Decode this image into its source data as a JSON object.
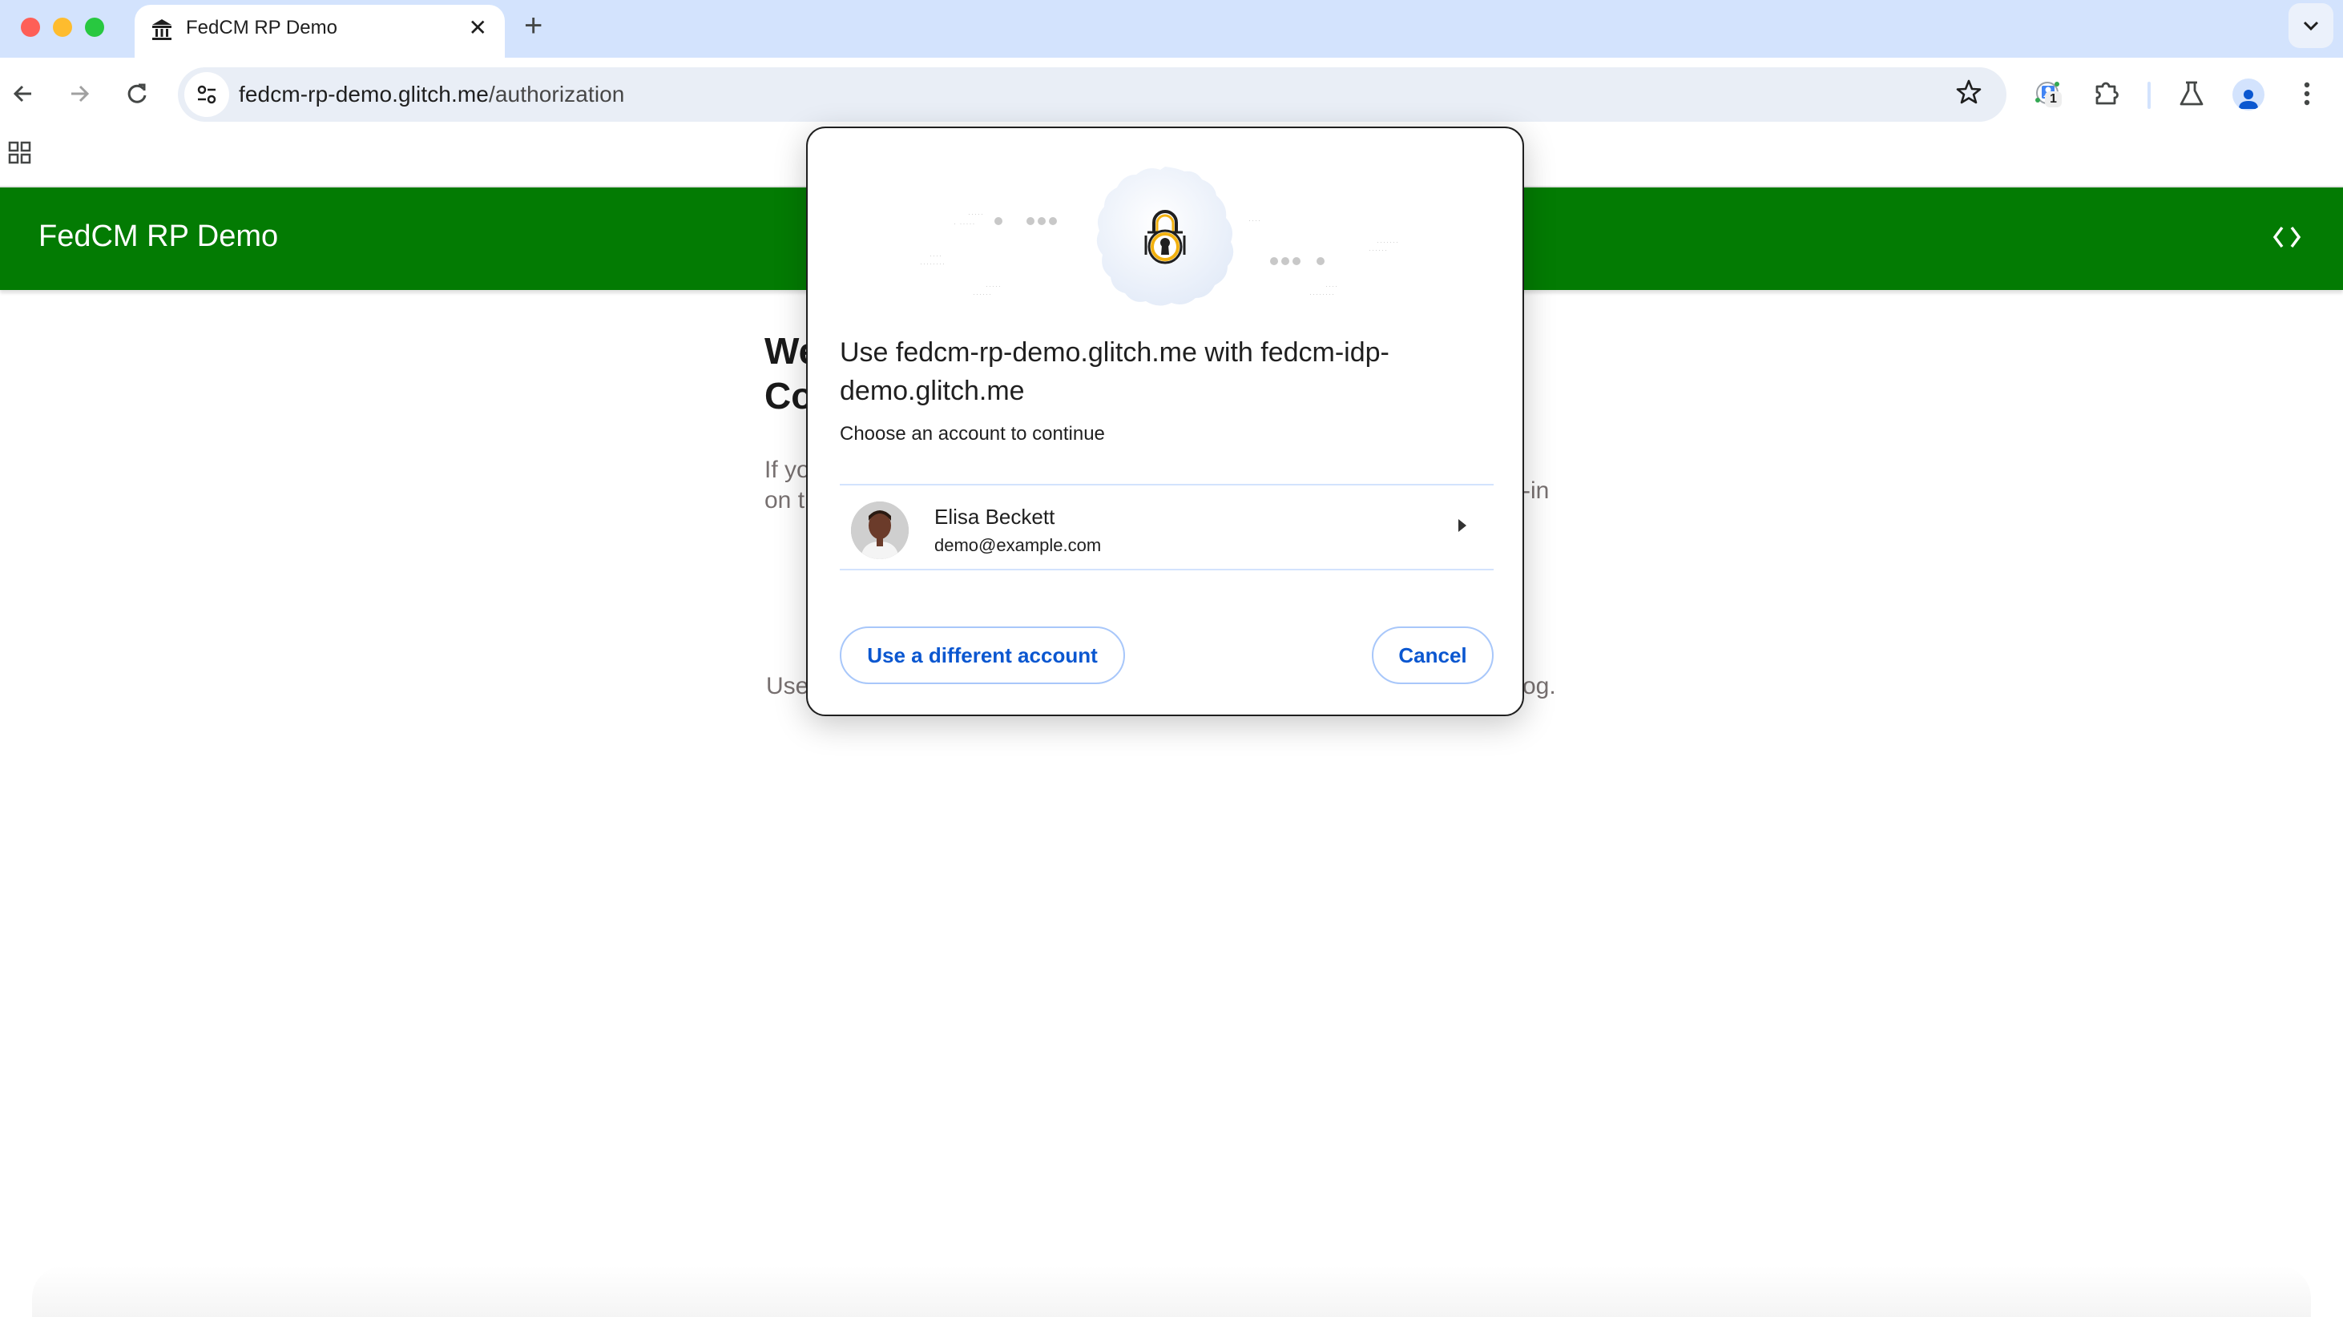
{
  "browser": {
    "tab": {
      "title": "FedCM RP Demo",
      "favicon": "bank-icon",
      "close_icon": "close-icon"
    },
    "new_tab_icon": "plus-icon",
    "tab_search_icon": "chevron-down-icon",
    "toolbar": {
      "back_icon": "arrow-left-icon",
      "forward_icon": "arrow-right-icon",
      "reload_icon": "reload-icon",
      "site_info_icon": "tune-icon",
      "url_host": "fedcm-rp-demo.glitch.me",
      "url_path": "/authorization",
      "bookmark_icon": "star-icon",
      "extension_badge": "1",
      "extensions_icon": "puzzle-icon",
      "labs_icon": "flask-icon",
      "profile_icon": "person-icon",
      "menu_icon": "kebab-menu-icon"
    },
    "bookmarks_bar": {
      "apps_icon": "apps-grid-icon"
    }
  },
  "page": {
    "header_title": "FedCM RP Demo",
    "code_icon": "code-icon",
    "welcome_line1": "We",
    "welcome_line2": "Co",
    "intro_left_1": "If yo",
    "intro_left_2": "on t",
    "intro_right_1": "-in",
    "note_left": "Use",
    "note_right": "og."
  },
  "dialog": {
    "title": "Use fedcm-rp-demo.glitch.me with fedcm-idp-demo.glitch.me",
    "subtitle": "Choose an account to continue",
    "illustration_icon": "padlock-icon",
    "accounts": [
      {
        "name": "Elisa Beckett",
        "email": "demo@example.com"
      }
    ],
    "use_different_account_label": "Use a different account",
    "cancel_label": "Cancel"
  },
  "colors": {
    "header_green": "#037b03",
    "tabstrip": "#d3e3fd",
    "button_text": "#0b57d0",
    "button_border": "#a8c7fa"
  }
}
